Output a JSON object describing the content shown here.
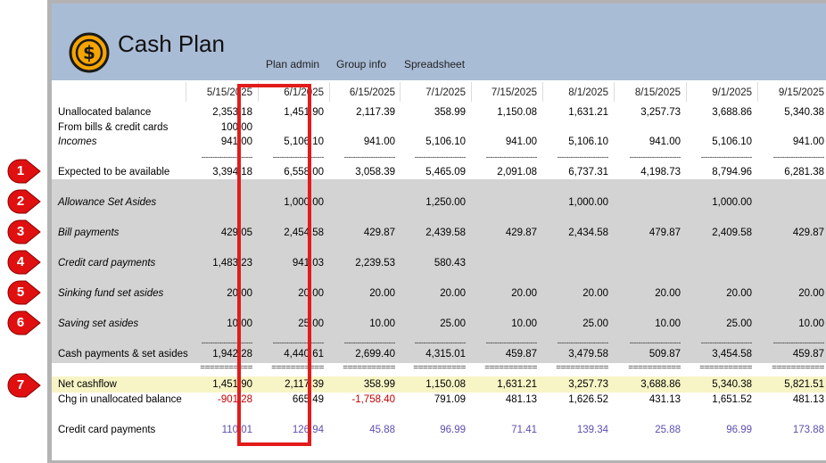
{
  "app": {
    "title": "Cash Plan",
    "logo_icon": "dollar-coin-icon"
  },
  "nav": [
    "Plan admin",
    "Group info",
    "Spreadsheet"
  ],
  "columns": [
    "5/15/2025",
    "6/1/2025",
    "6/15/2025",
    "7/1/2025",
    "7/15/2025",
    "8/1/2025",
    "8/15/2025",
    "9/1/2025",
    "9/15/2025"
  ],
  "separator_dashes": "-----------------------",
  "separator_equals": "===========",
  "rows": [
    {
      "label": "Unallocated balance",
      "values": [
        "2,353.18",
        "1,451.90",
        "2,117.39",
        "358.99",
        "1,150.08",
        "1,631.21",
        "3,257.73",
        "3,688.86",
        "5,340.38"
      ]
    },
    {
      "label": "From bills & credit cards",
      "values": [
        "100.00",
        "",
        "",
        "",
        "",
        "",
        "",
        "",
        ""
      ]
    },
    {
      "label": "Incomes",
      "values": [
        "941.00",
        "5,106.10",
        "941.00",
        "5,106.10",
        "941.00",
        "5,106.10",
        "941.00",
        "5,106.10",
        "941.00"
      ]
    },
    {
      "label": "Expected to be available",
      "values": [
        "3,394.18",
        "6,558.00",
        "3,058.39",
        "5,465.09",
        "2,091.08",
        "6,737.31",
        "4,198.73",
        "8,794.96",
        "6,281.38"
      ]
    },
    {
      "label": "Allowance Set Asides",
      "values": [
        "",
        "1,000.00",
        "",
        "1,250.00",
        "",
        "1,000.00",
        "",
        "1,000.00",
        ""
      ]
    },
    {
      "label": "Bill payments",
      "values": [
        "429.05",
        "2,454.58",
        "429.87",
        "2,439.58",
        "429.87",
        "2,434.58",
        "479.87",
        "2,409.58",
        "429.87"
      ]
    },
    {
      "label": "Credit card payments",
      "values": [
        "1,483.23",
        "941.03",
        "2,239.53",
        "580.43",
        "",
        "",
        "",
        "",
        ""
      ]
    },
    {
      "label": "Sinking fund set asides",
      "values": [
        "20.00",
        "20.00",
        "20.00",
        "20.00",
        "20.00",
        "20.00",
        "20.00",
        "20.00",
        "20.00"
      ]
    },
    {
      "label": "Saving set asides",
      "values": [
        "10.00",
        "25.00",
        "10.00",
        "25.00",
        "10.00",
        "25.00",
        "10.00",
        "25.00",
        "10.00"
      ]
    },
    {
      "label": "Cash payments & set asides",
      "values": [
        "1,942.28",
        "4,440.61",
        "2,699.40",
        "4,315.01",
        "459.87",
        "3,479.58",
        "509.87",
        "3,454.58",
        "459.87"
      ]
    },
    {
      "label": "Net cashflow",
      "values": [
        "1,451.90",
        "2,117.39",
        "358.99",
        "1,150.08",
        "1,631.21",
        "3,257.73",
        "3,688.86",
        "5,340.38",
        "5,821.51"
      ]
    },
    {
      "label": "Chg in unallocated balance",
      "values": [
        "-901.28",
        "665.49",
        "-1,758.40",
        "791.09",
        "481.13",
        "1,626.52",
        "431.13",
        "1,651.52",
        "481.13"
      ]
    },
    {
      "label": "Credit card payments",
      "values": [
        "110.01",
        "126.94",
        "45.88",
        "96.99",
        "71.41",
        "139.34",
        "25.88",
        "96.99",
        "173.88"
      ]
    }
  ],
  "callouts": [
    "1",
    "2",
    "3",
    "4",
    "5",
    "6",
    "7"
  ],
  "colors": {
    "header_bg": "#a9bcd6",
    "highlight": "#e21b1b",
    "negative": "#c00000",
    "credit_card_text": "#5a4fb0",
    "net_row_bg": "#f7f4c5",
    "gray_band": "#d3d3d3",
    "callout_bg": "#e01010"
  }
}
